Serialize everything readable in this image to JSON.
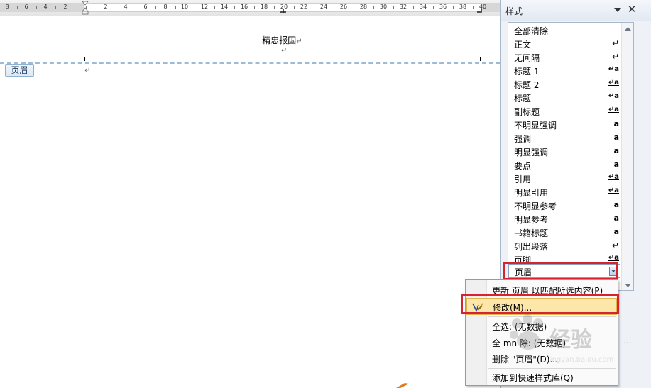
{
  "ruler": {
    "labels": [
      "8",
      "6",
      "4",
      "2",
      "2",
      "4",
      "6",
      "8",
      "10",
      "12",
      "14",
      "16",
      "18",
      "20",
      "22",
      "24",
      "26",
      "28",
      "30",
      "32",
      "34",
      "36",
      "38",
      "40"
    ]
  },
  "document": {
    "header_text": "精忠报国",
    "para_mark": "↵",
    "header_tag": "页眉"
  },
  "styles_pane": {
    "title": "样式",
    "close_glyph": "✕",
    "items": [
      {
        "label": "全部清除",
        "glyph": ""
      },
      {
        "label": "正文",
        "glyph": "↵",
        "glyph_type": "para"
      },
      {
        "label": "无间隔",
        "glyph": "↵",
        "glyph_type": "para"
      },
      {
        "label": "标题 1",
        "glyph": "↵a",
        "glyph_type": "link"
      },
      {
        "label": "标题 2",
        "glyph": "↵a",
        "glyph_type": "link"
      },
      {
        "label": "标题",
        "glyph": "↵a",
        "glyph_type": "link"
      },
      {
        "label": "副标题",
        "glyph": "↵a",
        "glyph_type": "link"
      },
      {
        "label": "不明显强调",
        "glyph": "a",
        "glyph_type": "char"
      },
      {
        "label": "强调",
        "glyph": "a",
        "glyph_type": "char"
      },
      {
        "label": "明显强调",
        "glyph": "a",
        "glyph_type": "char"
      },
      {
        "label": "要点",
        "glyph": "a",
        "glyph_type": "char"
      },
      {
        "label": "引用",
        "glyph": "↵a",
        "glyph_type": "link"
      },
      {
        "label": "明显引用",
        "glyph": "↵a",
        "glyph_type": "link"
      },
      {
        "label": "不明显参考",
        "glyph": "a",
        "glyph_type": "char"
      },
      {
        "label": "明显参考",
        "glyph": "a",
        "glyph_type": "char"
      },
      {
        "label": "书籍标题",
        "glyph": "a",
        "glyph_type": "char"
      },
      {
        "label": "列出段落",
        "glyph": "↵",
        "glyph_type": "para"
      },
      {
        "label": "页脚",
        "glyph": "↵a",
        "glyph_type": "link"
      }
    ],
    "selected_item": "页眉",
    "bottom_dots": "..."
  },
  "context_menu": {
    "items": [
      {
        "label": "更新 页眉 以匹配所选内容(P)"
      },
      {
        "label": "修改(M)..."
      },
      {
        "label": "全选: (无数据)"
      },
      {
        "label": "全 mn 除: (无数据)"
      },
      {
        "label": "删除 \"页眉\"(D)..."
      },
      {
        "label": "添加到快速样式库(Q)"
      }
    ]
  },
  "watermark": {
    "text": "经验",
    "sub": "jingyan.baidu.com"
  },
  "colors": {
    "highlight_red": "#d6232f",
    "menu_hover": "#fde6a9",
    "dash_line": "#9dbbd6"
  }
}
